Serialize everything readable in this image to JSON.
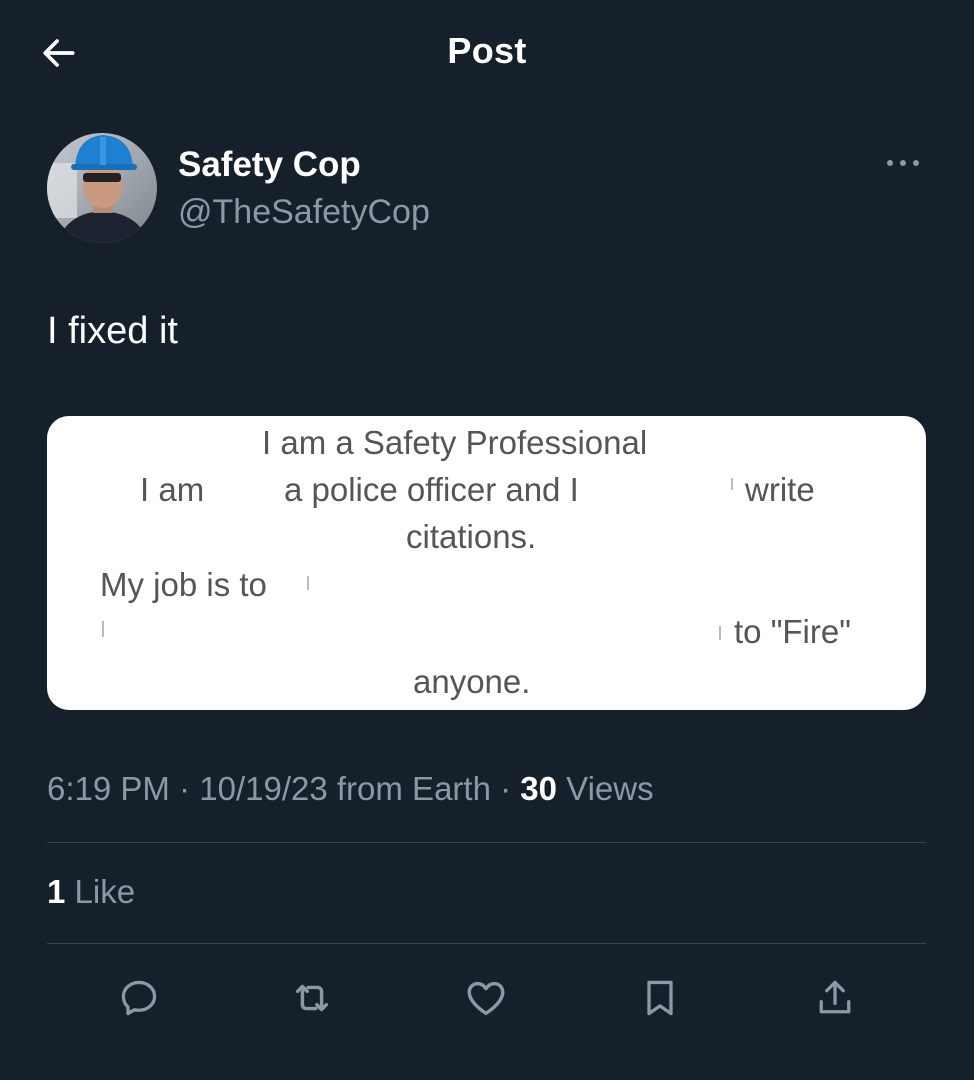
{
  "header": {
    "title": "Post",
    "back_icon": "arrow-left-icon"
  },
  "author": {
    "name": "Safety Cop",
    "handle": "@TheSafetyCop",
    "avatar": "avatar-photo"
  },
  "post": {
    "text": "I fixed it",
    "image_lines": [
      "I am a Safety Professional",
      "I am",
      "a police officer and I",
      "write",
      "citations.",
      "My job is to",
      "to \"Fire\"",
      "anyone."
    ]
  },
  "meta": {
    "time": "6:19 PM",
    "sep1": "·",
    "date": "10/19/23",
    "source": "from Earth",
    "sep2": "·",
    "views_count": "30",
    "views_label": "Views"
  },
  "stats": {
    "likes_count": "1",
    "likes_label": "Like"
  },
  "actions": {
    "reply": "reply-icon",
    "repost": "repost-icon",
    "like": "heart-icon",
    "bookmark": "bookmark-icon",
    "share": "share-icon"
  },
  "colors": {
    "background": "#15202b",
    "primary_text": "#ffffff",
    "secondary_text": "#8b98a5",
    "divider": "#38444d"
  }
}
